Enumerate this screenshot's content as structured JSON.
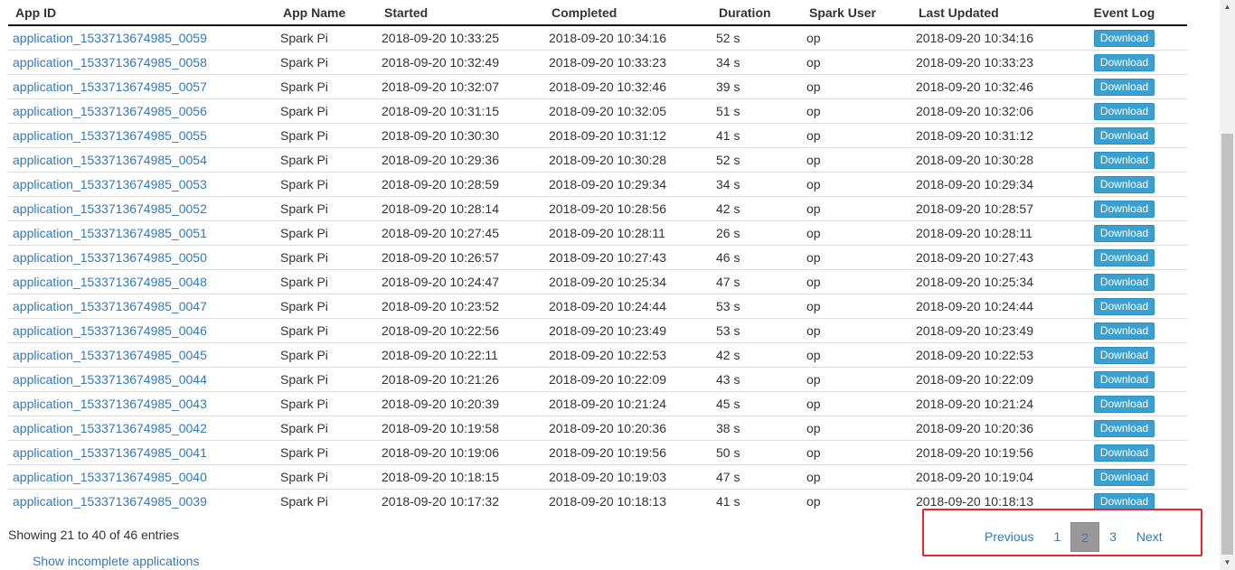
{
  "table": {
    "headers": [
      "App ID",
      "App Name",
      "Started",
      "Completed",
      "Duration",
      "Spark User",
      "Last Updated",
      "Event Log"
    ],
    "download_label": "Download",
    "rows": [
      {
        "id": "application_1533713674985_0059",
        "name": "Spark Pi",
        "started": "2018-09-20 10:33:25",
        "completed": "2018-09-20 10:34:16",
        "duration": "52 s",
        "user": "op",
        "updated": "2018-09-20 10:34:16"
      },
      {
        "id": "application_1533713674985_0058",
        "name": "Spark Pi",
        "started": "2018-09-20 10:32:49",
        "completed": "2018-09-20 10:33:23",
        "duration": "34 s",
        "user": "op",
        "updated": "2018-09-20 10:33:23"
      },
      {
        "id": "application_1533713674985_0057",
        "name": "Spark Pi",
        "started": "2018-09-20 10:32:07",
        "completed": "2018-09-20 10:32:46",
        "duration": "39 s",
        "user": "op",
        "updated": "2018-09-20 10:32:46"
      },
      {
        "id": "application_1533713674985_0056",
        "name": "Spark Pi",
        "started": "2018-09-20 10:31:15",
        "completed": "2018-09-20 10:32:05",
        "duration": "51 s",
        "user": "op",
        "updated": "2018-09-20 10:32:06"
      },
      {
        "id": "application_1533713674985_0055",
        "name": "Spark Pi",
        "started": "2018-09-20 10:30:30",
        "completed": "2018-09-20 10:31:12",
        "duration": "41 s",
        "user": "op",
        "updated": "2018-09-20 10:31:12"
      },
      {
        "id": "application_1533713674985_0054",
        "name": "Spark Pi",
        "started": "2018-09-20 10:29:36",
        "completed": "2018-09-20 10:30:28",
        "duration": "52 s",
        "user": "op",
        "updated": "2018-09-20 10:30:28"
      },
      {
        "id": "application_1533713674985_0053",
        "name": "Spark Pi",
        "started": "2018-09-20 10:28:59",
        "completed": "2018-09-20 10:29:34",
        "duration": "34 s",
        "user": "op",
        "updated": "2018-09-20 10:29:34"
      },
      {
        "id": "application_1533713674985_0052",
        "name": "Spark Pi",
        "started": "2018-09-20 10:28:14",
        "completed": "2018-09-20 10:28:56",
        "duration": "42 s",
        "user": "op",
        "updated": "2018-09-20 10:28:57"
      },
      {
        "id": "application_1533713674985_0051",
        "name": "Spark Pi",
        "started": "2018-09-20 10:27:45",
        "completed": "2018-09-20 10:28:11",
        "duration": "26 s",
        "user": "op",
        "updated": "2018-09-20 10:28:11"
      },
      {
        "id": "application_1533713674985_0050",
        "name": "Spark Pi",
        "started": "2018-09-20 10:26:57",
        "completed": "2018-09-20 10:27:43",
        "duration": "46 s",
        "user": "op",
        "updated": "2018-09-20 10:27:43"
      },
      {
        "id": "application_1533713674985_0048",
        "name": "Spark Pi",
        "started": "2018-09-20 10:24:47",
        "completed": "2018-09-20 10:25:34",
        "duration": "47 s",
        "user": "op",
        "updated": "2018-09-20 10:25:34"
      },
      {
        "id": "application_1533713674985_0047",
        "name": "Spark Pi",
        "started": "2018-09-20 10:23:52",
        "completed": "2018-09-20 10:24:44",
        "duration": "53 s",
        "user": "op",
        "updated": "2018-09-20 10:24:44"
      },
      {
        "id": "application_1533713674985_0046",
        "name": "Spark Pi",
        "started": "2018-09-20 10:22:56",
        "completed": "2018-09-20 10:23:49",
        "duration": "53 s",
        "user": "op",
        "updated": "2018-09-20 10:23:49"
      },
      {
        "id": "application_1533713674985_0045",
        "name": "Spark Pi",
        "started": "2018-09-20 10:22:11",
        "completed": "2018-09-20 10:22:53",
        "duration": "42 s",
        "user": "op",
        "updated": "2018-09-20 10:22:53"
      },
      {
        "id": "application_1533713674985_0044",
        "name": "Spark Pi",
        "started": "2018-09-20 10:21:26",
        "completed": "2018-09-20 10:22:09",
        "duration": "43 s",
        "user": "op",
        "updated": "2018-09-20 10:22:09"
      },
      {
        "id": "application_1533713674985_0043",
        "name": "Spark Pi",
        "started": "2018-09-20 10:20:39",
        "completed": "2018-09-20 10:21:24",
        "duration": "45 s",
        "user": "op",
        "updated": "2018-09-20 10:21:24"
      },
      {
        "id": "application_1533713674985_0042",
        "name": "Spark Pi",
        "started": "2018-09-20 10:19:58",
        "completed": "2018-09-20 10:20:36",
        "duration": "38 s",
        "user": "op",
        "updated": "2018-09-20 10:20:36"
      },
      {
        "id": "application_1533713674985_0041",
        "name": "Spark Pi",
        "started": "2018-09-20 10:19:06",
        "completed": "2018-09-20 10:19:56",
        "duration": "50 s",
        "user": "op",
        "updated": "2018-09-20 10:19:56"
      },
      {
        "id": "application_1533713674985_0040",
        "name": "Spark Pi",
        "started": "2018-09-20 10:18:15",
        "completed": "2018-09-20 10:19:03",
        "duration": "47 s",
        "user": "op",
        "updated": "2018-09-20 10:19:04"
      },
      {
        "id": "application_1533713674985_0039",
        "name": "Spark Pi",
        "started": "2018-09-20 10:17:32",
        "completed": "2018-09-20 10:18:13",
        "duration": "41 s",
        "user": "op",
        "updated": "2018-09-20 10:18:13"
      }
    ]
  },
  "info": "Showing 21 to 40 of 46 entries",
  "incomplete_link": "Show incomplete applications",
  "pagination": {
    "previous": "Previous",
    "pages": [
      "1",
      "2",
      "3"
    ],
    "current": "2",
    "next": "Next"
  },
  "colors": {
    "link": "#337ab7",
    "download_button": "#3aa0d0",
    "highlight_box": "#e8262b",
    "current_page": "#999999"
  }
}
